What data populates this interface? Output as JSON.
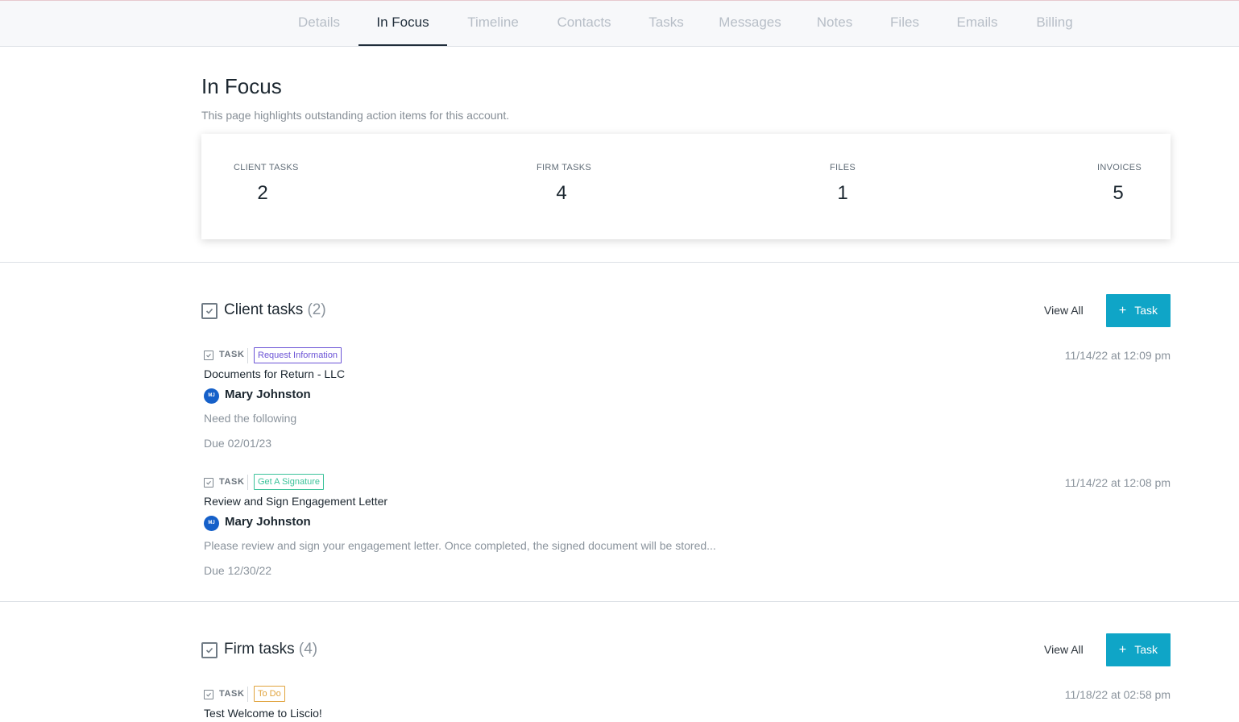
{
  "tabs": [
    {
      "label": "Details",
      "active": false
    },
    {
      "label": "In Focus",
      "active": true
    },
    {
      "label": "Timeline",
      "active": false
    },
    {
      "label": "Contacts",
      "active": false
    },
    {
      "label": "Tasks",
      "active": false
    },
    {
      "label": "Messages",
      "active": false
    },
    {
      "label": "Notes",
      "active": false
    },
    {
      "label": "Files",
      "active": false
    },
    {
      "label": "Emails",
      "active": false
    },
    {
      "label": "Billing",
      "active": false
    }
  ],
  "page": {
    "title": "In Focus",
    "description": "This page highlights outstanding action items for this account."
  },
  "summary": [
    {
      "label": "CLIENT TASKS",
      "value": "2"
    },
    {
      "label": "FIRM TASKS",
      "value": "4"
    },
    {
      "label": "FILES",
      "value": "1"
    },
    {
      "label": "INVOICES",
      "value": "5"
    }
  ],
  "client_tasks": {
    "title": "Client tasks",
    "count": "(2)",
    "view_all": "View All",
    "add_button": "Task",
    "add_icon": "+",
    "items": [
      {
        "type": "TASK",
        "tag": "Request Information",
        "tag_color": "#6b53d6",
        "title": "Documents for Return - LLC",
        "assignee_initials": "MJ",
        "assignee": "Mary Johnston",
        "description": "Need the following",
        "due": "Due 02/01/23",
        "date": "11/14/22 at 12:09 pm"
      },
      {
        "type": "TASK",
        "tag": "Get A Signature",
        "tag_color": "#3cc29a",
        "title": "Review and Sign Engagement Letter",
        "assignee_initials": "MJ",
        "assignee": "Mary Johnston",
        "description": "Please review and sign your engagement letter. Once completed, the signed document will be stored...",
        "due": "Due 12/30/22",
        "date": "11/14/22 at 12:08 pm"
      }
    ]
  },
  "firm_tasks": {
    "title": "Firm tasks",
    "count": "(4)",
    "view_all": "View All",
    "add_button": "Task",
    "add_icon": "+",
    "items": [
      {
        "type": "TASK",
        "tag": "To Do",
        "tag_color": "#e0a33c",
        "title": "Test Welcome to Liscio!",
        "date": "11/18/22 at 02:58 pm"
      }
    ]
  },
  "colors": {
    "accent": "#0fa5c7",
    "avatar": "#1560c9"
  }
}
